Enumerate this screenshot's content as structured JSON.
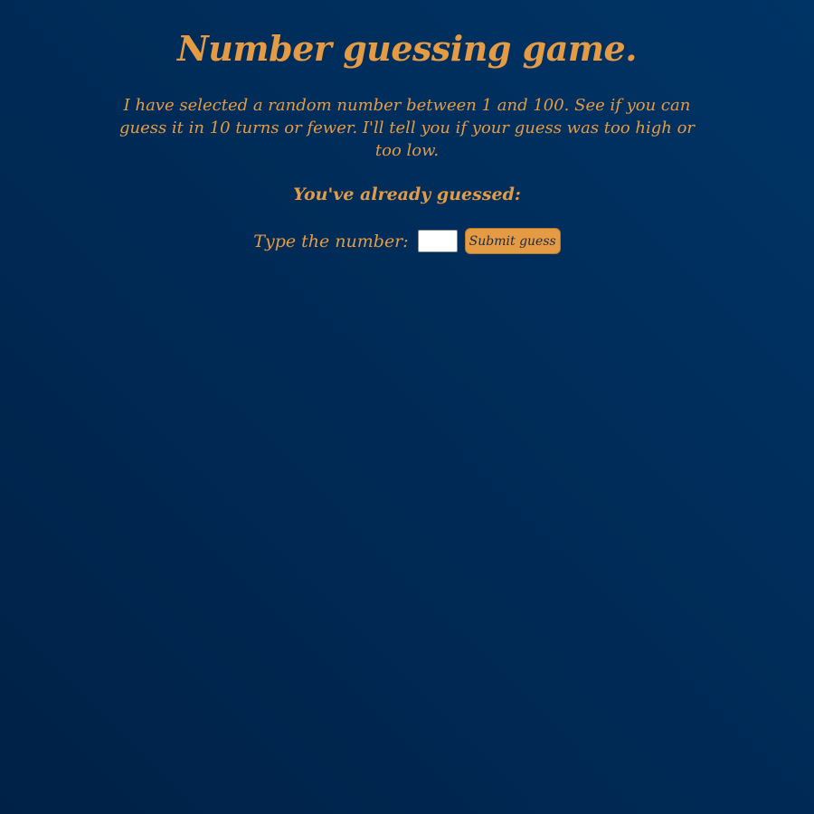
{
  "page": {
    "title": "Number guessing game.",
    "intro": "I have selected a random number between 1 and 100. See if you can guess it in 10 turns or fewer. I'll tell you if your guess was too high or too low.",
    "guessed_label": "You've already guessed:"
  },
  "form": {
    "label": "Type the number:",
    "input_value": "",
    "submit_label": "Submit guess"
  },
  "colors": {
    "accent": "#e49b44",
    "background_start": "#002147",
    "background_end": "#003466"
  }
}
